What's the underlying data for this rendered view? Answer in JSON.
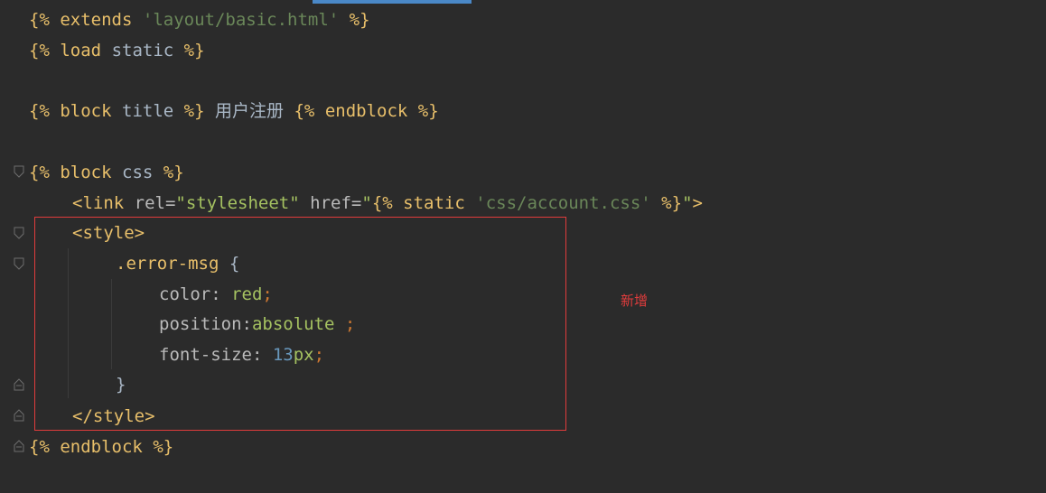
{
  "editor": {
    "lines": {
      "l1": {
        "open": "{%",
        "kw": "extends",
        "str": "'layout/basic.html'",
        "close": "%}"
      },
      "l2": {
        "open": "{%",
        "kw": "load",
        "word": "static",
        "close": "%}"
      },
      "l4": {
        "open": "{%",
        "kw": "block",
        "word": "title",
        "close": "%}",
        "text": "用户注册",
        "open2": "{%",
        "kw2": "endblock",
        "close2": "%}"
      },
      "l6": {
        "open": "{%",
        "kw": "block",
        "word": "css",
        "close": "%}"
      },
      "l7": {
        "tag_open": "<link",
        "attr1": "rel=",
        "val1": "\"stylesheet\"",
        "attr2": "href=",
        "q1": "\"",
        "tpl_open": "{%",
        "tpl_kw": "static",
        "tpl_str": "'css/account.css'",
        "tpl_close": "%}",
        "q2": "\"",
        "tag_close": ">"
      },
      "l8": {
        "tag": "<style>"
      },
      "l9": {
        "selector": ".error-msg",
        "brace": "{"
      },
      "l10": {
        "prop": "color:",
        "value": "red",
        "semi": ";"
      },
      "l11": {
        "prop": "position:",
        "value": "absolute",
        "semi": ";"
      },
      "l12": {
        "prop": "font-size:",
        "num": "13",
        "unit": "px",
        "semi": ";"
      },
      "l13": {
        "brace": "}"
      },
      "l14": {
        "tag": "</style>"
      },
      "l15": {
        "open": "{%",
        "kw": "endblock",
        "close": "%}"
      }
    }
  },
  "annotation": {
    "text": "新增",
    "color": "#e03c3c"
  },
  "colors": {
    "background": "#2b2b2b",
    "template_delim": "#e8bf6a",
    "string": "#6a8759",
    "attr_value": "#a5c261",
    "number": "#6897bb",
    "highlight_border": "#e03c3c"
  }
}
